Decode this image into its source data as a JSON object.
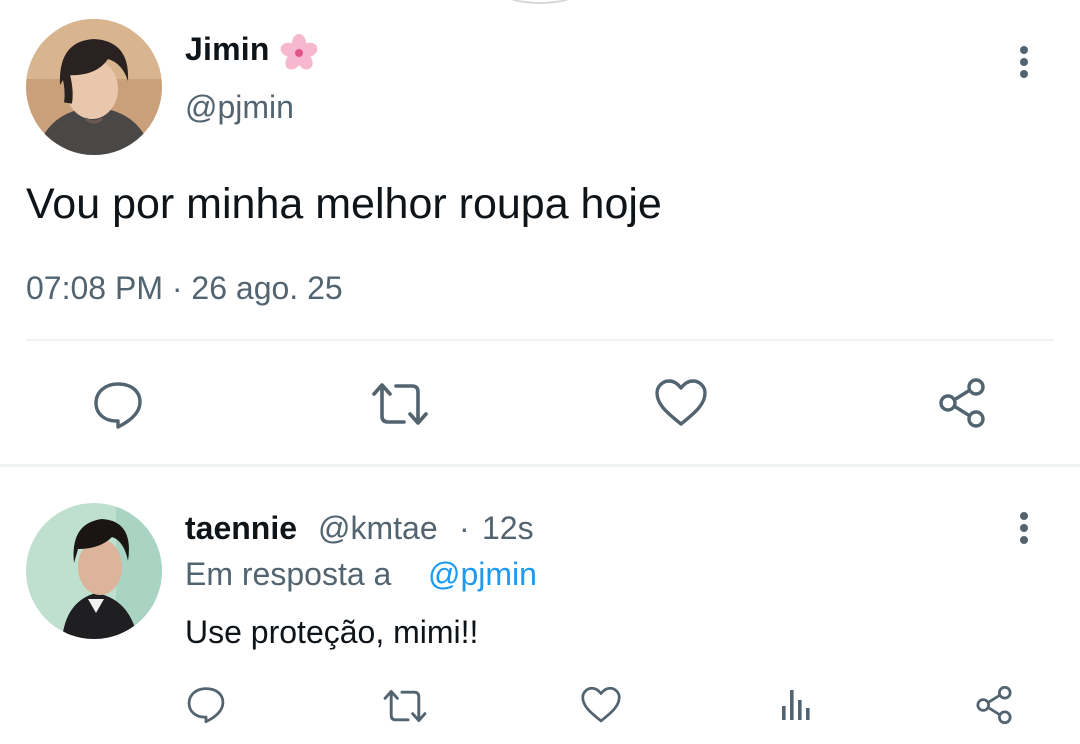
{
  "main_tweet": {
    "display_name": "Jimin",
    "name_emoji": "cherry-blossom",
    "handle": "@pjmin",
    "text": "Vou por minha melhor roupa hoje",
    "timestamp": "07:08 PM · 26 ago. 25",
    "actions": [
      "reply-icon",
      "retweet-icon",
      "like-icon",
      "share-icon"
    ]
  },
  "reply": {
    "display_name": "taennie",
    "handle": "@kmtae",
    "separator": "·",
    "time": "12s",
    "in_reply_prefix": "Em resposta a",
    "in_reply_mention": "@pjmin",
    "text": "Use proteção, mimi!!",
    "actions": [
      "reply-icon",
      "retweet-icon",
      "like-icon",
      "analytics-icon",
      "share-icon"
    ]
  },
  "colors": {
    "text": "#0f1419",
    "secondary": "#536471",
    "link": "#1d9bf0",
    "divider": "#eff3f4"
  }
}
